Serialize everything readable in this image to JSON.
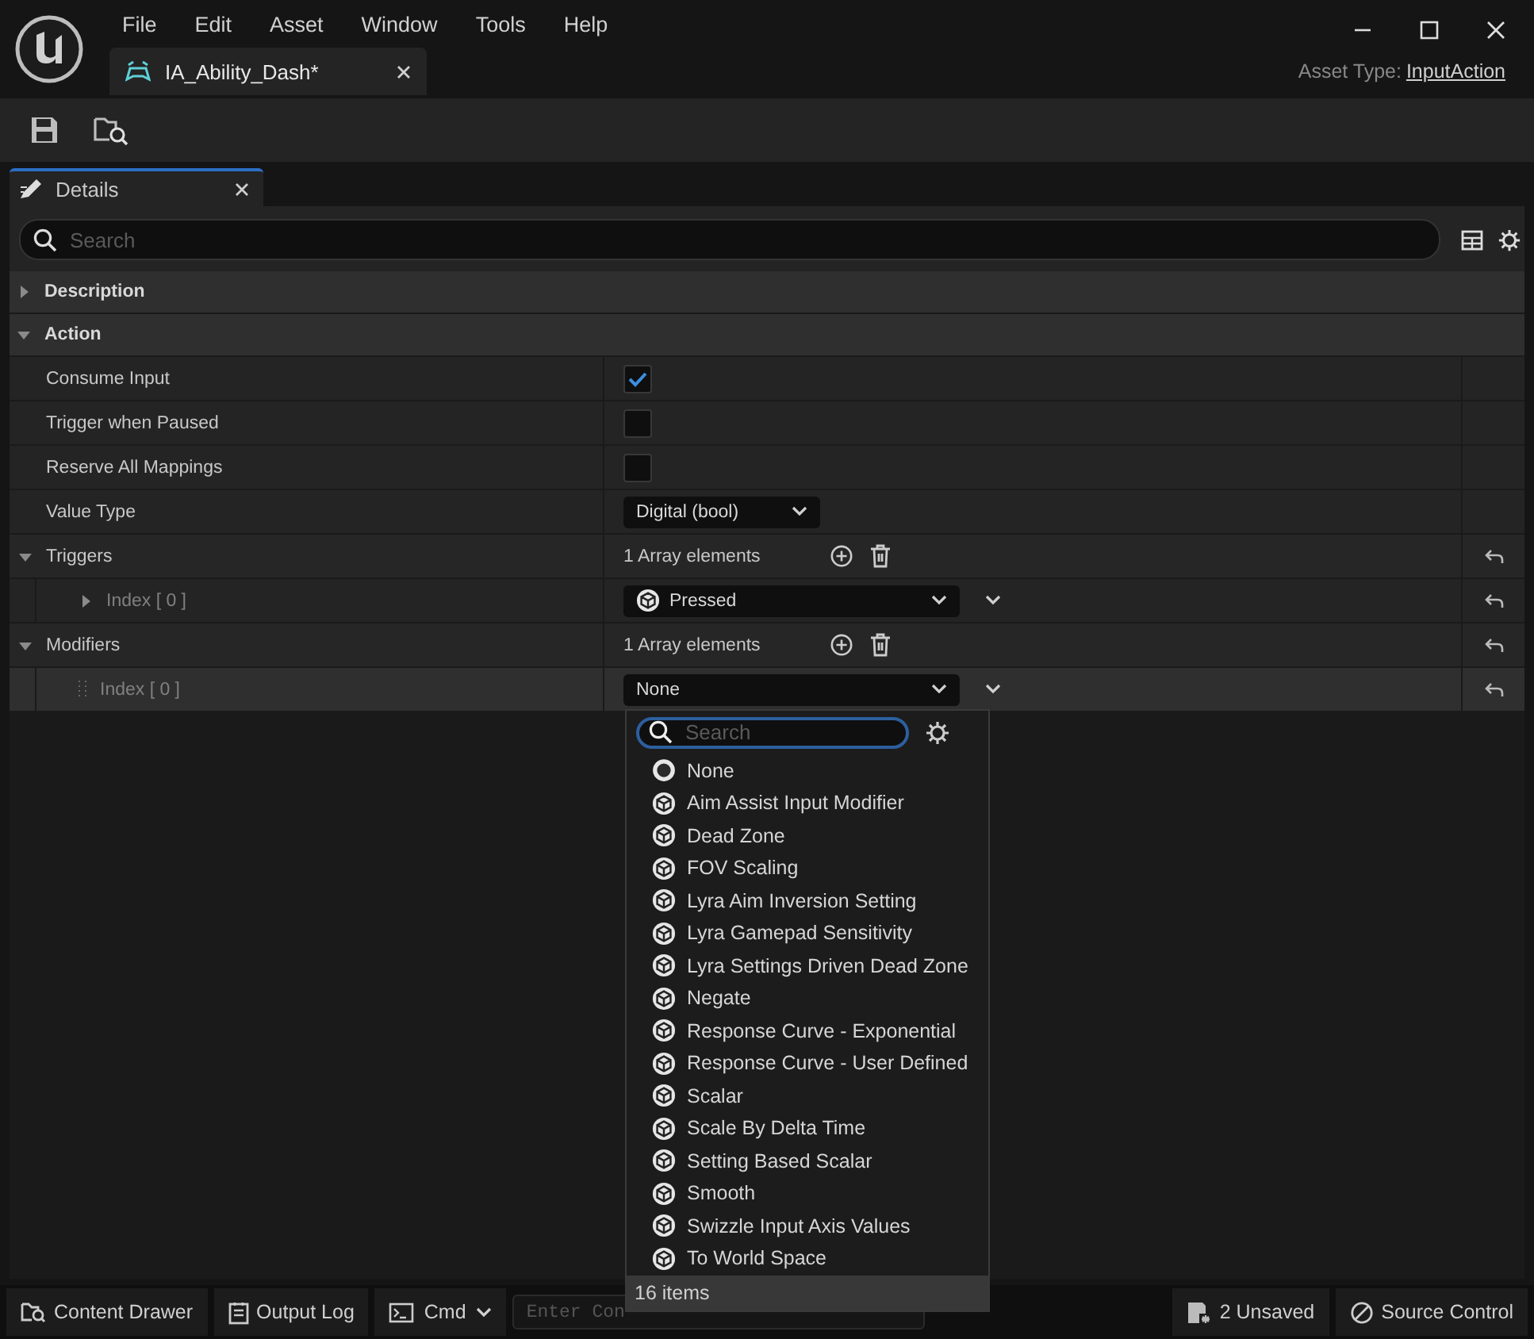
{
  "menu": [
    "File",
    "Edit",
    "Asset",
    "Window",
    "Tools",
    "Help"
  ],
  "document_tab": {
    "title": "IA_Ability_Dash*",
    "selected": true
  },
  "asset_type": {
    "label": "Asset Type:",
    "value": "InputAction"
  },
  "details_tab": {
    "title": "Details"
  },
  "search": {
    "placeholder": "Search"
  },
  "categories": [
    {
      "label": "Description",
      "expanded": false
    },
    {
      "label": "Action",
      "expanded": true,
      "properties": [
        {
          "kind": "checkbox",
          "label": "Consume Input",
          "checked": true
        },
        {
          "kind": "checkbox",
          "label": "Trigger when Paused",
          "checked": false
        },
        {
          "kind": "checkbox",
          "label": "Reserve All Mappings",
          "checked": false
        },
        {
          "kind": "dropdown",
          "label": "Value Type",
          "value": "Digital (bool)"
        },
        {
          "kind": "array",
          "label": "Triggers",
          "expanded": true,
          "count": "1 Array elements",
          "items": [
            {
              "label": "Index [ 0 ]",
              "value": "Pressed",
              "has_icon": true,
              "expandable": true,
              "selected": false
            }
          ]
        },
        {
          "kind": "array",
          "label": "Modifiers",
          "expanded": true,
          "count": "1 Array elements",
          "items": [
            {
              "label": "Index [ 0 ]",
              "value": "None",
              "has_icon": false,
              "expandable": false,
              "selected": true
            }
          ]
        }
      ]
    }
  ],
  "popup": {
    "search_placeholder": "Search",
    "footer": "16 items",
    "options": [
      {
        "label": "None",
        "kind": "none"
      },
      {
        "label": "Aim Assist Input Modifier",
        "kind": "class"
      },
      {
        "label": "Dead Zone",
        "kind": "class"
      },
      {
        "label": "FOV Scaling",
        "kind": "class"
      },
      {
        "label": "Lyra Aim Inversion Setting",
        "kind": "class"
      },
      {
        "label": "Lyra Gamepad Sensitivity",
        "kind": "class"
      },
      {
        "label": "Lyra Settings Driven Dead Zone",
        "kind": "class"
      },
      {
        "label": "Negate",
        "kind": "class"
      },
      {
        "label": "Response Curve - Exponential",
        "kind": "class"
      },
      {
        "label": "Response Curve - User Defined",
        "kind": "class"
      },
      {
        "label": "Scalar",
        "kind": "class"
      },
      {
        "label": "Scale By Delta Time",
        "kind": "class"
      },
      {
        "label": "Setting Based Scalar",
        "kind": "class"
      },
      {
        "label": "Smooth",
        "kind": "class"
      },
      {
        "label": "Swizzle Input Axis Values",
        "kind": "class"
      },
      {
        "label": "To World Space",
        "kind": "class"
      }
    ]
  },
  "status_bar": {
    "content_drawer": "Content Drawer",
    "output_log": "Output Log",
    "cmd": "Cmd",
    "console_placeholder": "Enter Con",
    "unsaved": "2 Unsaved",
    "source_control": "Source Control"
  }
}
